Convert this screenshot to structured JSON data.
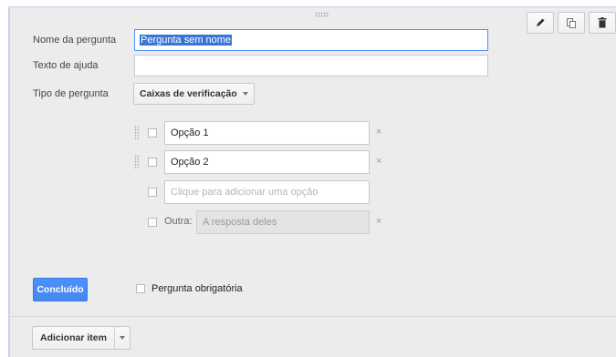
{
  "question": {
    "name_label": "Nome da pergunta",
    "name_value": "Pergunta sem nome",
    "help_label": "Texto de ajuda",
    "help_value": "",
    "type_label": "Tipo de pergunta",
    "type_value": "Caixas de verificação"
  },
  "tools": {
    "edit_icon": "pencil-icon",
    "duplicate_icon": "copy-icon",
    "delete_icon": "trash-icon"
  },
  "options": [
    {
      "value": "Opção 1",
      "remove": "×"
    },
    {
      "value": "Opção 2",
      "remove": "×"
    }
  ],
  "add_option": {
    "placeholder": "Clique para adicionar uma opção"
  },
  "other": {
    "label": "Outra:",
    "placeholder": "A resposta deles",
    "remove": "×"
  },
  "footer": {
    "done_label": "Concluído",
    "required_label": "Pergunta obrigatória"
  },
  "bottom": {
    "add_item_label": "Adicionar item"
  },
  "colors": {
    "accent": "#4d90fe",
    "card_bg": "#ececec",
    "selection": "#3875d7"
  }
}
